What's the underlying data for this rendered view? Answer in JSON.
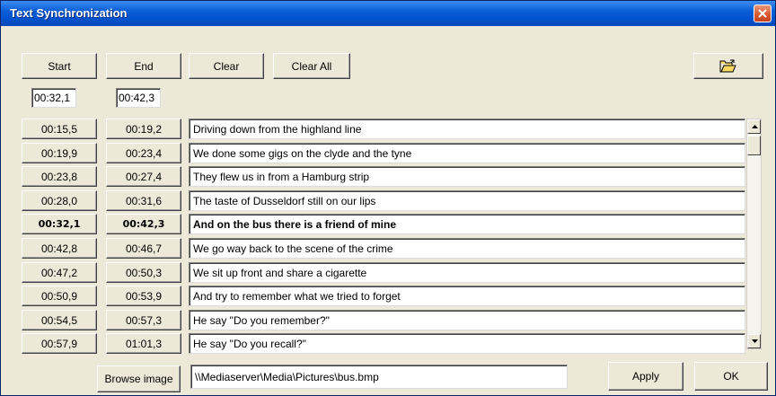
{
  "window": {
    "title": "Text Synchronization"
  },
  "toolbar": {
    "start_label": "Start",
    "end_label": "End",
    "clear_label": "Clear",
    "clear_all_label": "Clear All",
    "open_icon": "open-folder-icon"
  },
  "current": {
    "start": "00:32,1",
    "end": "00:42,3"
  },
  "rows": [
    {
      "start": "00:15,5",
      "end": "00:19,2",
      "text": "Driving down from the highland line"
    },
    {
      "start": "00:19,9",
      "end": "00:23,4",
      "text": "We done some gigs on the clyde and the tyne"
    },
    {
      "start": "00:23,8",
      "end": "00:27,4",
      "text": "They flew us in from a Hamburg strip"
    },
    {
      "start": "00:28,0",
      "end": "00:31,6",
      "text": "The taste of Dusseldorf still on our lips"
    },
    {
      "start": "00:32,1",
      "end": "00:42,3",
      "text": "And on the bus there is a friend of mine",
      "active": true
    },
    {
      "start": "00:42,8",
      "end": "00:46,7",
      "text": "We go way back to the scene of the crime"
    },
    {
      "start": "00:47,2",
      "end": "00:50,3",
      "text": "We sit up front and share a cigarette"
    },
    {
      "start": "00:50,9",
      "end": "00:53,9",
      "text": "And try to remember what we tried to forget"
    },
    {
      "start": "00:54,5",
      "end": "00:57,3",
      "text": "He say \"Do you remember?\""
    },
    {
      "start": "00:57,9",
      "end": "01:01,3",
      "text": "He say \"Do you recall?\""
    }
  ],
  "footer": {
    "browse_label": "Browse image",
    "image_path": "\\\\Mediaserver\\Media\\Pictures\\bus.bmp",
    "apply_label": "Apply",
    "ok_label": "OK"
  },
  "colors": {
    "titlebar": "#0a5fd8",
    "window_bg": "#ece9d8",
    "close_button": "#d8572d"
  }
}
